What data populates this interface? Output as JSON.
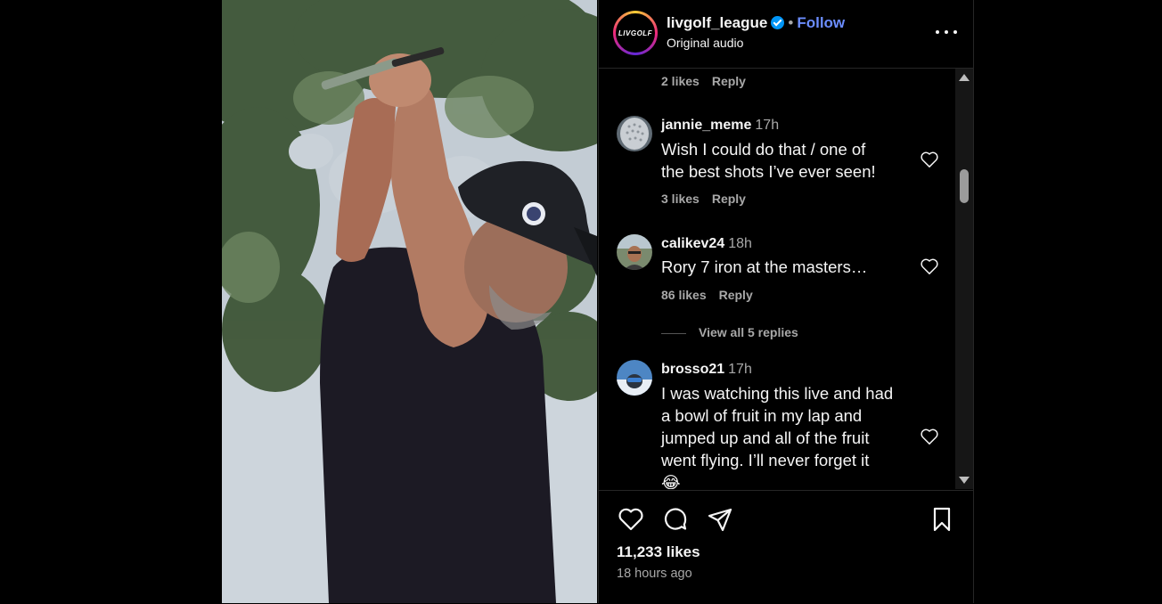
{
  "header": {
    "username": "livgolf_league",
    "separator": "•",
    "follow_label": "Follow",
    "subtitle": "Original audio",
    "avatar_logo_text": "LIVGOLF"
  },
  "comments": {
    "top_meta": {
      "likes": "2 likes",
      "reply": "Reply"
    },
    "items": [
      {
        "username": "jannie_meme",
        "time": "17h",
        "lines": [
          "Wish I could do that / one of",
          "the best shots I’ve ever seen!"
        ],
        "likes": "3 likes",
        "reply": "Reply"
      },
      {
        "username": "calikev24",
        "time": "18h",
        "lines": [
          "Rory 7 iron at the masters…"
        ],
        "likes": "86 likes",
        "reply": "Reply",
        "view_replies": "View all 5 replies"
      },
      {
        "username": "brosso21",
        "time": "17h",
        "lines": [
          "I was watching this live and had",
          "a bowl of fruit in my lap and",
          "jumped up and all of the fruit",
          "went flying. I’ll never forget it",
          "😂"
        ]
      }
    ]
  },
  "footer": {
    "likes": "11,233 likes",
    "time_ago": "18 hours ago",
    "icons": [
      "heart-icon",
      "comment-icon",
      "share-icon",
      "bookmark-icon"
    ]
  },
  "colors": {
    "background": "#000000",
    "text": "#f5f5f5",
    "muted": "#a8a8a8",
    "follow": "#6b8dff",
    "verified": "#0095f6"
  }
}
